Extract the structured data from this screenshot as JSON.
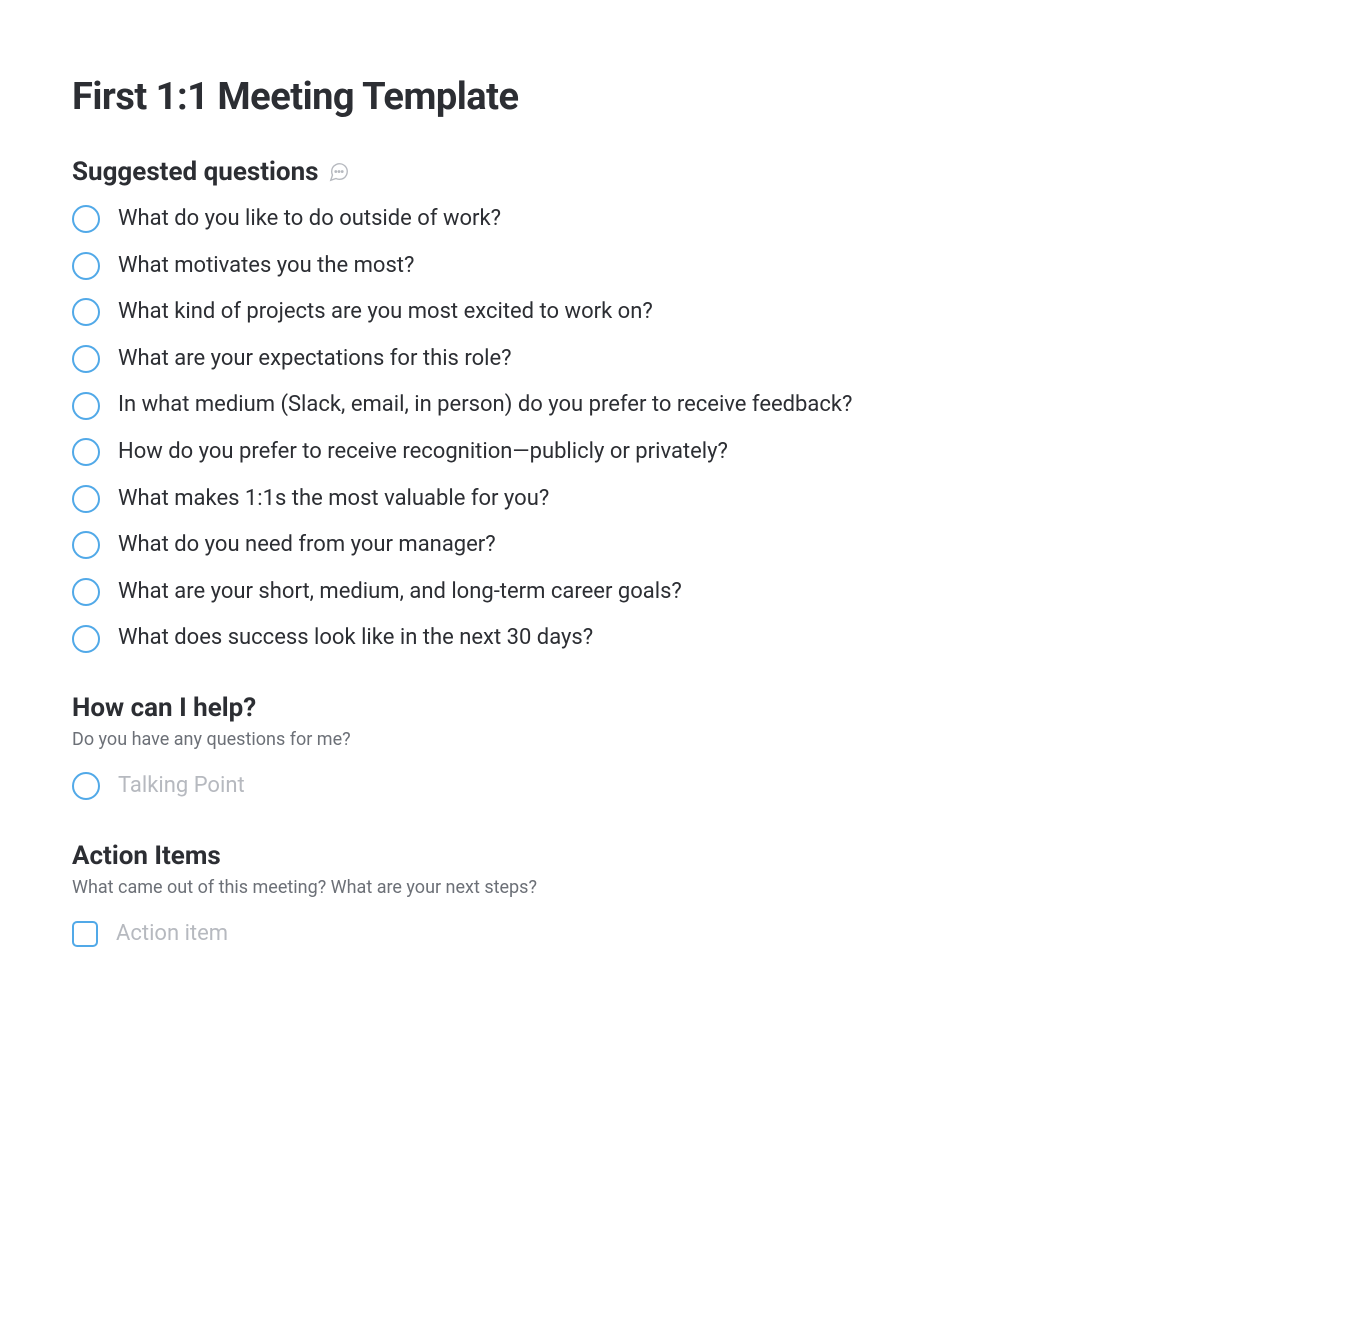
{
  "title": "First 1:1 Meeting Template",
  "sections": {
    "suggested": {
      "heading": "Suggested questions",
      "questions": [
        "What do you like to do outside of work?",
        "What motivates you the most?",
        "What kind of projects are you most excited to work on?",
        "What are your expectations for this role?",
        "In what medium (Slack, email, in person) do you prefer to receive feedback?",
        "How do you prefer to receive recognition—publicly or privately?",
        "What makes 1:1s the most valuable for you?",
        "What do you need from your manager?",
        "What are your short, medium, and long-term career goals?",
        "What does success look like in the next 30 days?"
      ]
    },
    "help": {
      "heading": "How can I help?",
      "subtext": "Do you have any questions for me?",
      "placeholder": "Talking Point"
    },
    "action": {
      "heading": "Action Items",
      "subtext": "What came out of this meeting? What are your next steps?",
      "placeholder": "Action item"
    }
  }
}
